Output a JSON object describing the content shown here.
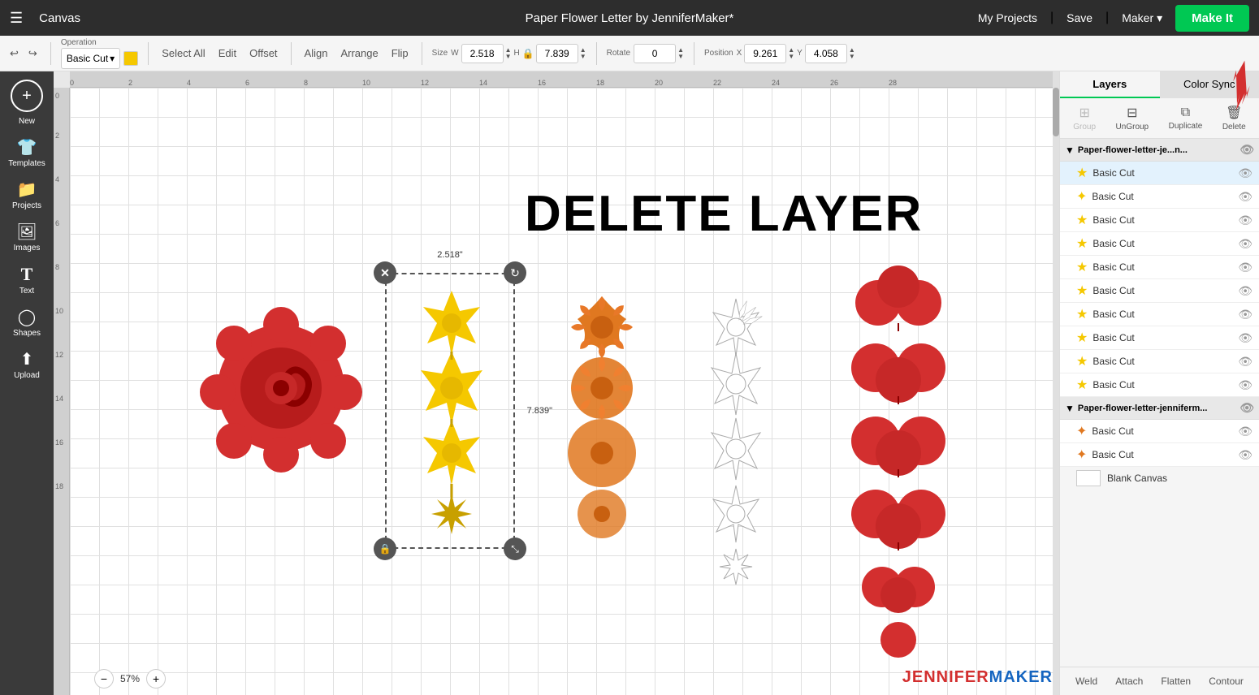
{
  "nav": {
    "hamburger": "☰",
    "app_title": "Canvas",
    "doc_title": "Paper Flower Letter by JenniferMaker*",
    "my_projects": "My Projects",
    "save": "Save",
    "divider": "|",
    "maker": "Maker",
    "make_it": "Make It"
  },
  "toolbar": {
    "undo_label": "↩",
    "redo_label": "↪",
    "operation_label": "Operation",
    "operation_value": "Basic Cut",
    "select_all": "Select All",
    "edit": "Edit",
    "offset": "Offset",
    "align": "Align",
    "arrange": "Arrange",
    "flip": "Flip",
    "size_label": "Size",
    "size_w_label": "W",
    "size_w_value": "2.518",
    "size_h_label": "H",
    "size_h_value": "7.839",
    "rotate_label": "Rotate",
    "rotate_value": "0",
    "position_label": "Position",
    "pos_x_label": "X",
    "pos_x_value": "9.261",
    "pos_y_label": "Y",
    "pos_y_value": "4.058"
  },
  "sidebar": {
    "new_label": "New",
    "items": [
      {
        "id": "templates",
        "icon": "👕",
        "label": "Templates"
      },
      {
        "id": "projects",
        "icon": "📁",
        "label": "Projects"
      },
      {
        "id": "images",
        "icon": "🖼",
        "label": "Images"
      },
      {
        "id": "text",
        "icon": "T",
        "label": "Text"
      },
      {
        "id": "shapes",
        "icon": "◯",
        "label": "Shapes"
      },
      {
        "id": "upload",
        "icon": "⬆",
        "label": "Upload"
      }
    ]
  },
  "canvas": {
    "delete_layer_text": "DELETE LAYER",
    "dimension_w": "2.518\"",
    "dimension_h": "7.839\"",
    "zoom_value": "57%"
  },
  "right_panel": {
    "tabs": [
      {
        "id": "layers",
        "label": "Layers"
      },
      {
        "id": "color-sync",
        "label": "Color Sync"
      }
    ],
    "toolbar": [
      {
        "id": "group",
        "label": "Group",
        "icon": "⊞",
        "disabled": false
      },
      {
        "id": "ungroup",
        "label": "UnGroup",
        "icon": "⊟",
        "disabled": false
      },
      {
        "id": "duplicate",
        "label": "Duplicate",
        "icon": "⧉",
        "disabled": false
      },
      {
        "id": "delete",
        "label": "Delete",
        "icon": "🗑",
        "disabled": false
      }
    ],
    "groups": [
      {
        "id": "group1",
        "name": "Paper-flower-letter-je...n...",
        "visible": true,
        "layers": [
          {
            "id": "l1",
            "name": "Basic Cut",
            "color": "#f5c800",
            "icon": "★",
            "selected": true,
            "visible": true
          },
          {
            "id": "l2",
            "name": "Basic Cut",
            "color": "#f5c800",
            "icon": "✦",
            "selected": false,
            "visible": true
          },
          {
            "id": "l3",
            "name": "Basic Cut",
            "color": "#f5c800",
            "icon": "★",
            "selected": false,
            "visible": true
          },
          {
            "id": "l4",
            "name": "Basic Cut",
            "color": "#f5c800",
            "icon": "★",
            "selected": false,
            "visible": true
          },
          {
            "id": "l5",
            "name": "Basic Cut",
            "color": "#f5c800",
            "icon": "★",
            "selected": false,
            "visible": true
          },
          {
            "id": "l6",
            "name": "Basic Cut",
            "color": "#f5c800",
            "icon": "★",
            "selected": false,
            "visible": true
          },
          {
            "id": "l7",
            "name": "Basic Cut",
            "color": "#f5c800",
            "icon": "★",
            "selected": false,
            "visible": true
          },
          {
            "id": "l8",
            "name": "Basic Cut",
            "color": "#f5c800",
            "icon": "★",
            "selected": false,
            "visible": true
          },
          {
            "id": "l9",
            "name": "Basic Cut",
            "color": "#f5c800",
            "icon": "★",
            "selected": false,
            "visible": true
          },
          {
            "id": "l10",
            "name": "Basic Cut",
            "color": "#f5c800",
            "icon": "★",
            "selected": false,
            "visible": true
          }
        ]
      },
      {
        "id": "group2",
        "name": "Paper-flower-letter-jenniferm...",
        "visible": true,
        "layers": [
          {
            "id": "l11",
            "name": "Basic Cut",
            "color": "#e07820",
            "icon": "✦",
            "selected": false,
            "visible": true
          },
          {
            "id": "l12",
            "name": "Basic Cut",
            "color": "#e07820",
            "icon": "✦",
            "selected": false,
            "visible": true
          }
        ]
      }
    ],
    "blank_canvas": "Blank Canvas",
    "bottom_actions": [
      {
        "id": "weld",
        "label": "Weld"
      },
      {
        "id": "attach",
        "label": "Attach"
      },
      {
        "id": "flatten",
        "label": "Flatten"
      },
      {
        "id": "contour",
        "label": "Contour"
      }
    ]
  },
  "watermark": {
    "part1": "JENNIFER",
    "part2": "MAKER"
  }
}
